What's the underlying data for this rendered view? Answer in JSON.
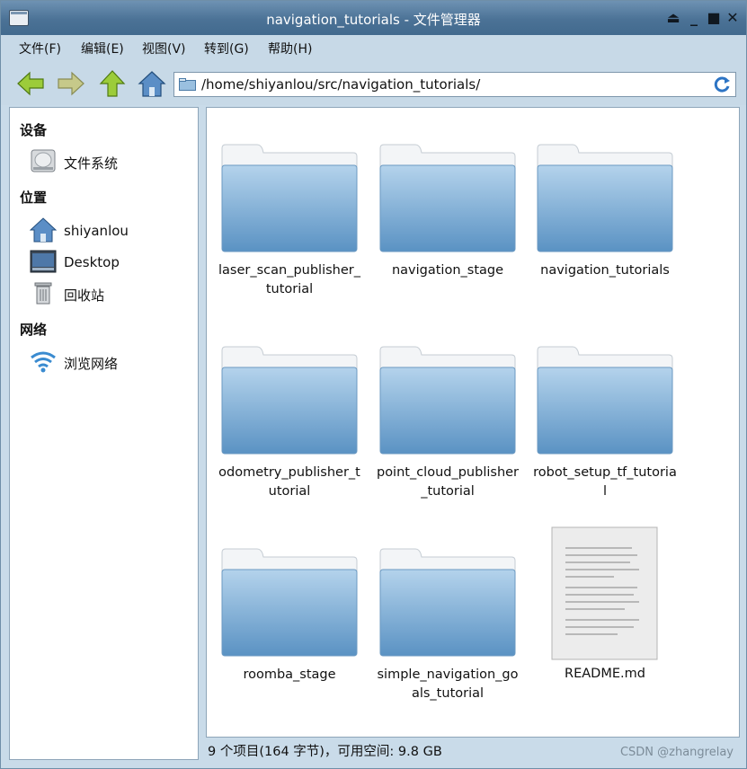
{
  "window": {
    "title": "navigation_tutorials - 文件管理器"
  },
  "menu": [
    {
      "label": "文件(F)"
    },
    {
      "label": "编辑(E)"
    },
    {
      "label": "视图(V)"
    },
    {
      "label": "转到(G)"
    },
    {
      "label": "帮助(H)"
    }
  ],
  "toolbar": {
    "back_icon": "back-arrow-icon",
    "forward_icon": "forward-arrow-icon",
    "up_icon": "up-arrow-icon",
    "home_icon": "home-icon",
    "path": "/home/shiyanlou/src/navigation_tutorials/",
    "reload_icon": "reload-icon"
  },
  "sidebar": {
    "sections": [
      {
        "title": "设备",
        "items": [
          {
            "label": "文件系统",
            "icon": "harddisk-icon"
          }
        ]
      },
      {
        "title": "位置",
        "items": [
          {
            "label": "shiyanlou",
            "icon": "home-icon"
          },
          {
            "label": "Desktop",
            "icon": "desktop-icon"
          },
          {
            "label": "回收站",
            "icon": "trash-icon"
          }
        ]
      },
      {
        "title": "网络",
        "items": [
          {
            "label": "浏览网络",
            "icon": "wifi-icon"
          }
        ]
      }
    ]
  },
  "files": [
    {
      "name": "laser_scan_publisher_\ntutorial",
      "type": "folder"
    },
    {
      "name": "navigation_stage",
      "type": "folder"
    },
    {
      "name": "navigation_tutorials",
      "type": "folder"
    },
    {
      "name": "odometry_publisher_t\nutorial",
      "type": "folder"
    },
    {
      "name": "point_cloud_publisher\n_tutorial",
      "type": "folder"
    },
    {
      "name": "robot_setup_tf_tutoria\nl",
      "type": "folder"
    },
    {
      "name": "roomba_stage",
      "type": "folder"
    },
    {
      "name": "simple_navigation_go\nals_tutorial",
      "type": "folder"
    },
    {
      "name": "README.md",
      "type": "file"
    }
  ],
  "status": {
    "text": "9 个项目(164 字节)，可用空间: 9.8 GB"
  },
  "watermark": "CSDN @zhangrelay",
  "colors": {
    "titlebar": "#4b7296",
    "chrome": "#c7d9e7",
    "folder_top": "#a8cbe6",
    "folder_bottom": "#5e95c4"
  }
}
